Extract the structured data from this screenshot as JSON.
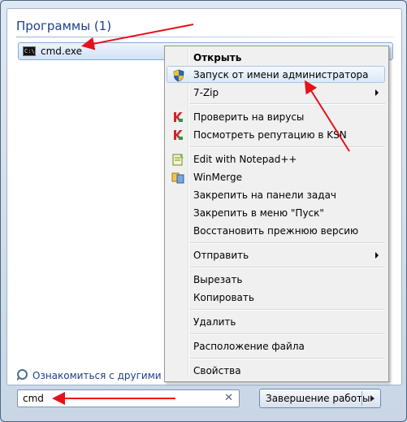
{
  "programs_header": "Программы (1)",
  "program": {
    "label": "cmd.exe",
    "icon": "cmd-console-icon"
  },
  "context_menu": {
    "items": [
      {
        "label": "Открыть",
        "bold": true
      },
      {
        "label": "Запуск от имени администратора",
        "icon": "uac-shield-icon",
        "highlighted": true
      },
      {
        "label": "7-Zip",
        "submenu": true
      },
      {
        "label": "Проверить на вирусы",
        "icon": "kaspersky-icon"
      },
      {
        "label": "Посмотреть репутацию в KSN",
        "icon": "kaspersky-icon"
      },
      {
        "label": "Edit with Notepad++",
        "icon": "notepad-plus-plus-icon"
      },
      {
        "label": "WinMerge",
        "icon": "winmerge-icon"
      },
      {
        "label": "Закрепить на панели задач"
      },
      {
        "label": "Закрепить в меню \"Пуск\""
      },
      {
        "label": "Восстановить прежнюю версию"
      },
      {
        "label": "Отправить",
        "submenu": true
      },
      {
        "label": "Вырезать"
      },
      {
        "label": "Копировать"
      },
      {
        "label": "Удалить"
      },
      {
        "label": "Расположение файла"
      },
      {
        "label": "Свойства"
      }
    ]
  },
  "see_more": "Ознакомиться с другими результатами",
  "search": {
    "value": "cmd",
    "clear_icon": "close-icon"
  },
  "shutdown": {
    "label": "Завершение работы"
  },
  "colors": {
    "annotation_arrow": "#e8101a",
    "header_text": "#1e3f8a"
  }
}
